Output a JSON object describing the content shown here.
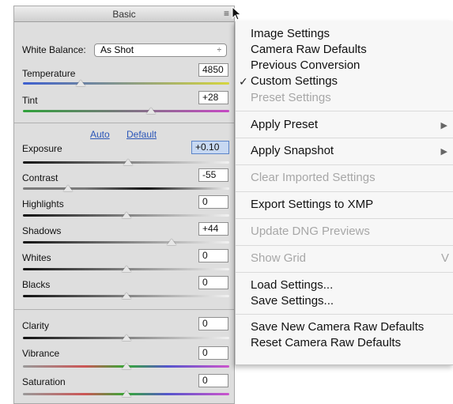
{
  "panel": {
    "title": "Basic",
    "white_balance_label": "White Balance:",
    "white_balance_value": "As Shot",
    "white_balance_arrows": "÷",
    "auto_link": "Auto",
    "default_link": "Default",
    "sliders": [
      {
        "label": "Temperature",
        "value": "4850",
        "level": 0.28
      },
      {
        "label": "Tint",
        "value": "+28",
        "level": 0.62
      },
      {
        "label": "Exposure",
        "value": "+0.10",
        "level": 0.51
      },
      {
        "label": "Contrast",
        "value": "-55",
        "level": 0.22
      },
      {
        "label": "Highlights",
        "value": "0",
        "level": 0.5
      },
      {
        "label": "Shadows",
        "value": "+44",
        "level": 0.72
      },
      {
        "label": "Whites",
        "value": "0",
        "level": 0.5
      },
      {
        "label": "Blacks",
        "value": "0",
        "level": 0.5
      },
      {
        "label": "Clarity",
        "value": "0",
        "level": 0.5
      },
      {
        "label": "Vibrance",
        "value": "0",
        "level": 0.5
      },
      {
        "label": "Saturation",
        "value": "0",
        "level": 0.5
      }
    ]
  },
  "menu": {
    "items": [
      {
        "label": "Image Settings",
        "enabled": true
      },
      {
        "label": "Camera Raw Defaults",
        "enabled": true
      },
      {
        "label": "Previous Conversion",
        "enabled": true
      },
      {
        "label": "Custom Settings",
        "enabled": true,
        "checked": true
      },
      {
        "label": "Preset Settings",
        "enabled": false
      },
      {
        "label": "Apply Preset",
        "enabled": true,
        "submenu": true
      },
      {
        "label": "Apply Snapshot",
        "enabled": true,
        "submenu": true
      },
      {
        "label": "Clear Imported Settings",
        "enabled": false
      },
      {
        "label": "Export Settings to XMP",
        "enabled": true
      },
      {
        "label": "Update DNG Previews",
        "enabled": false
      },
      {
        "label": "Show Grid",
        "enabled": false,
        "shortcut": "V"
      },
      {
        "label": "Load Settings...",
        "enabled": true
      },
      {
        "label": "Save Settings...",
        "enabled": true
      },
      {
        "label": "Save New Camera Raw Defaults",
        "enabled": true
      },
      {
        "label": "Reset Camera Raw Defaults",
        "enabled": true
      }
    ],
    "check_glyph": "✓",
    "submenu_glyph": "▶"
  }
}
